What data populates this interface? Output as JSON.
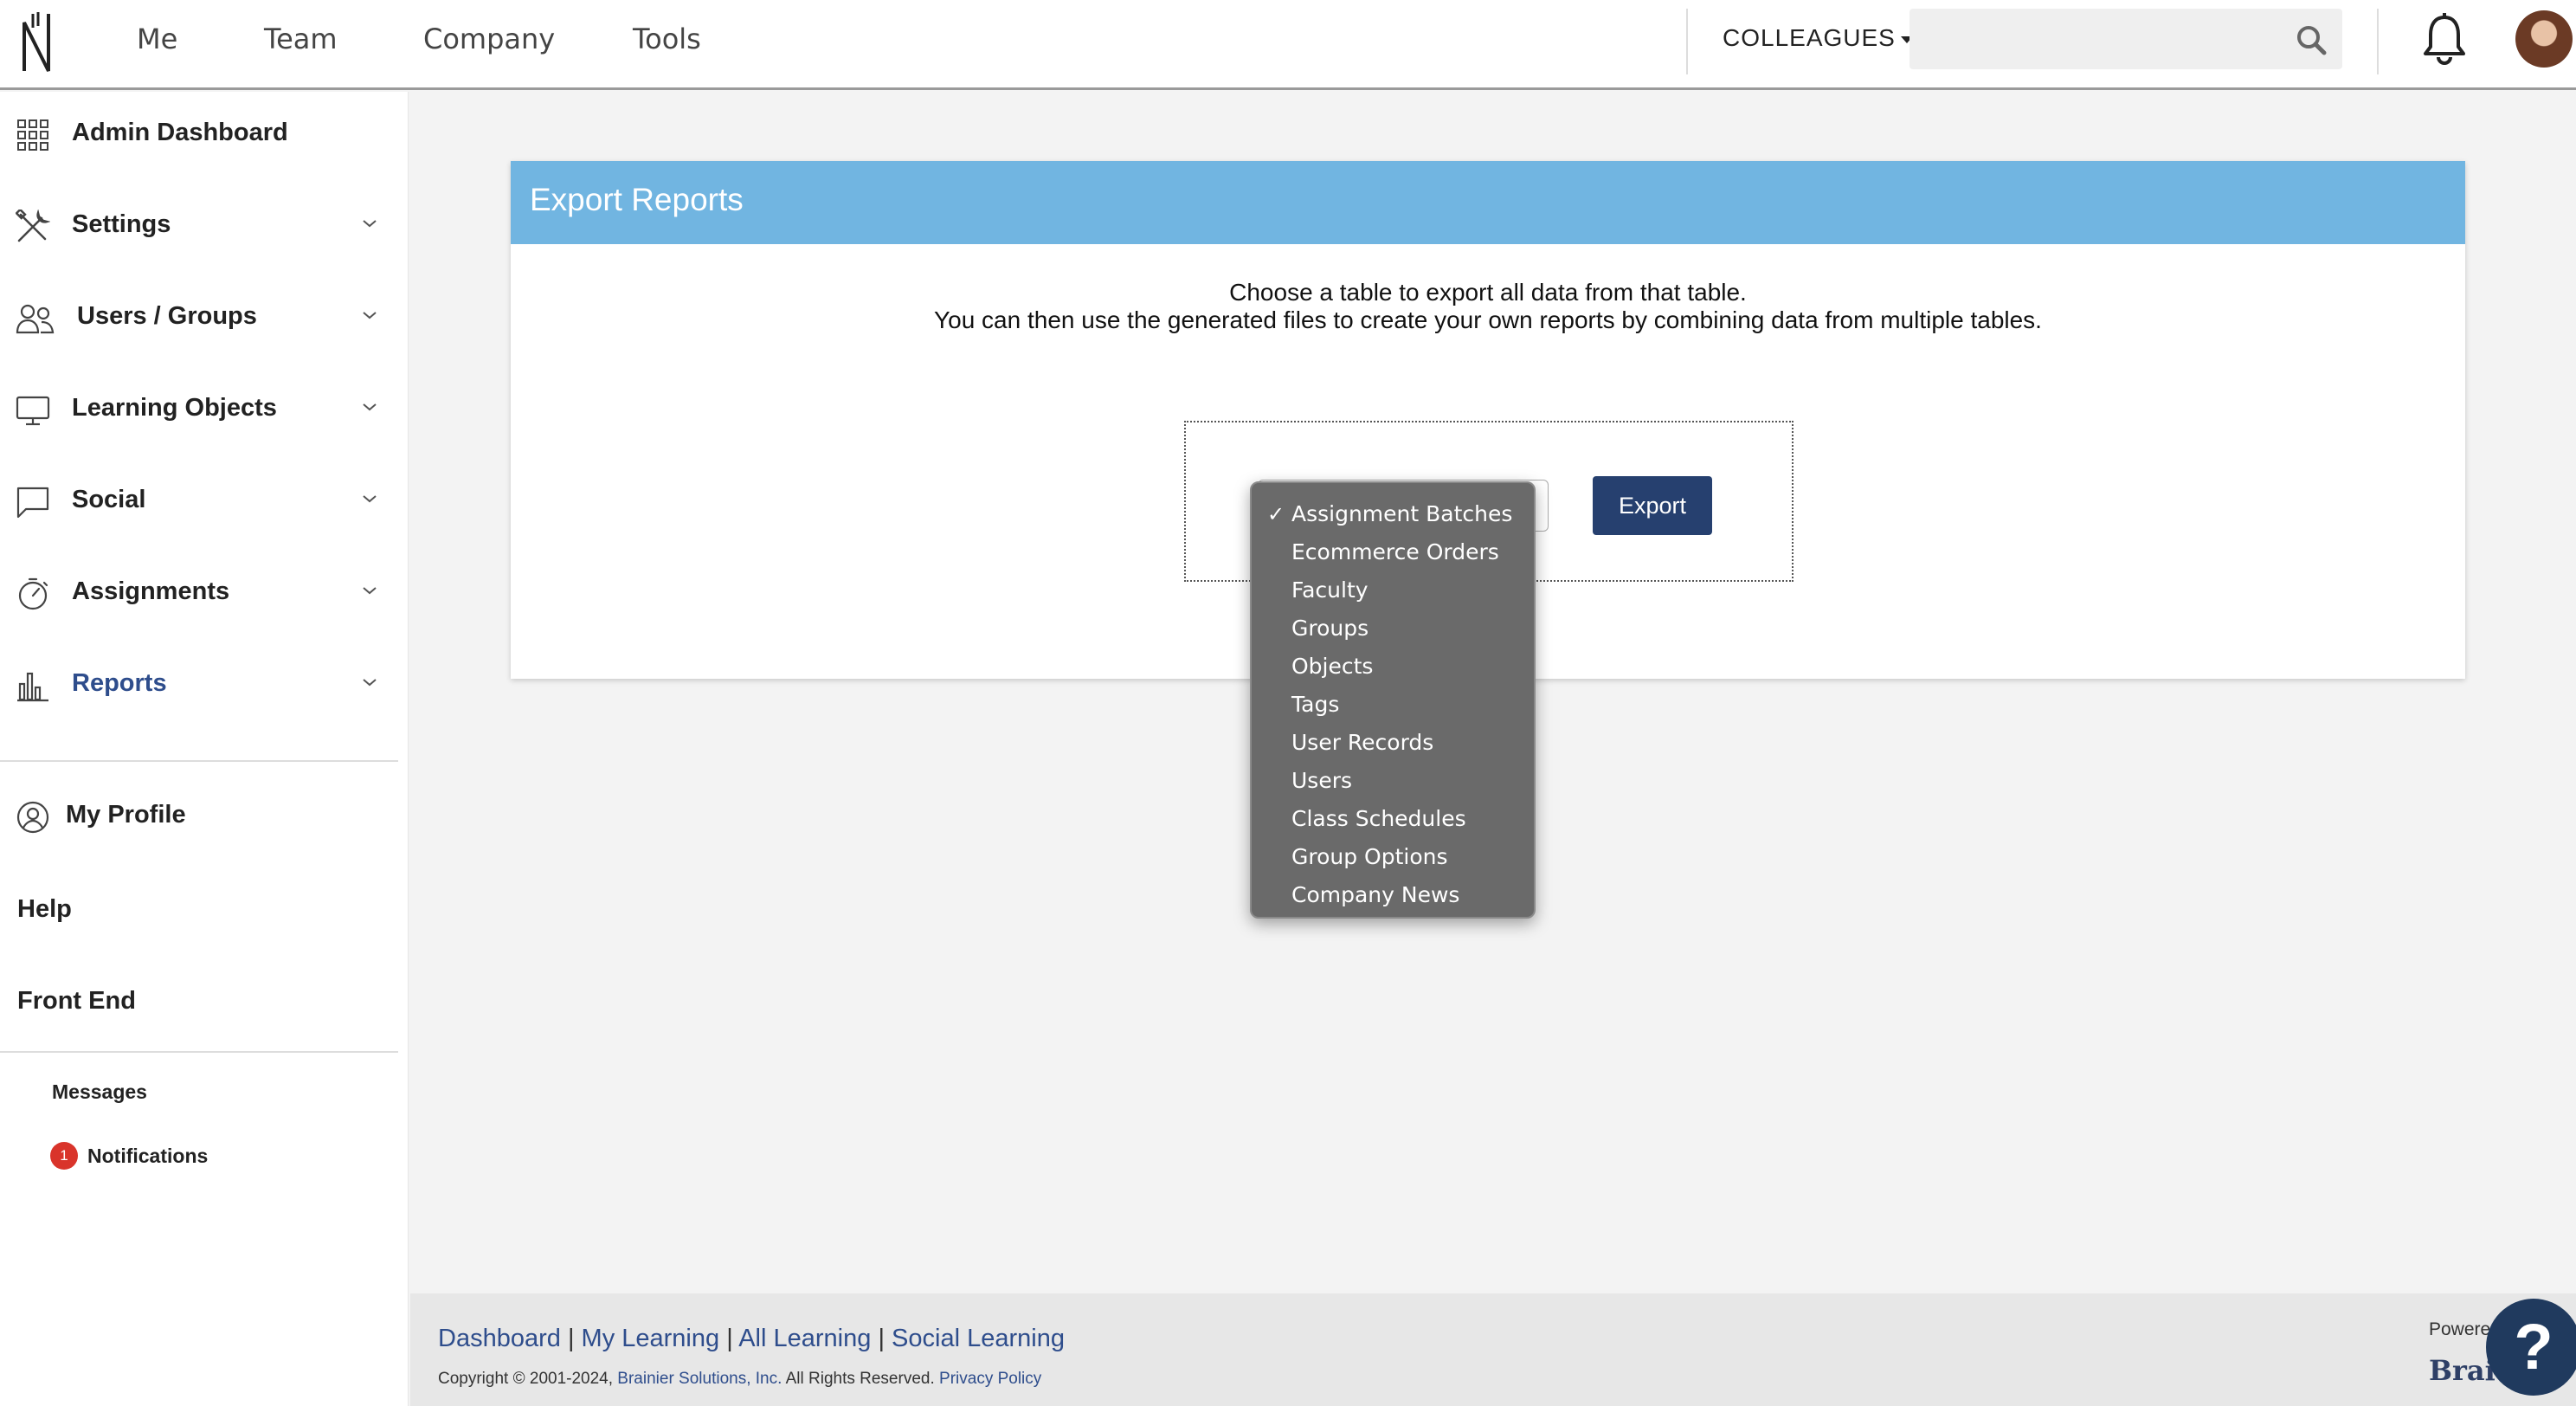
{
  "topnav": {
    "items": [
      "Me",
      "Team",
      "Company",
      "Tools"
    ],
    "colleagues_label": "COLLEAGUES",
    "search_placeholder": ""
  },
  "sidebar": {
    "items": [
      {
        "label": "Admin Dashboard",
        "icon": "grid-icon",
        "expandable": false
      },
      {
        "label": "Settings",
        "icon": "tools-icon",
        "expandable": true
      },
      {
        "label": "Users / Groups",
        "icon": "users-icon",
        "expandable": true
      },
      {
        "label": "Learning Objects",
        "icon": "monitor-icon",
        "expandable": true
      },
      {
        "label": "Social",
        "icon": "chat-icon",
        "expandable": true
      },
      {
        "label": "Assignments",
        "icon": "stopwatch-icon",
        "expandable": true
      },
      {
        "label": "Reports",
        "icon": "bar-chart-icon",
        "expandable": true,
        "active": true
      }
    ],
    "my_profile": "My Profile",
    "help": "Help",
    "front_end": "Front End",
    "messages": "Messages",
    "notifications": "Notifications",
    "notifications_count": "1"
  },
  "panel": {
    "title": "Export Reports",
    "instruction_1": "Choose a table to export all data from that table.",
    "instruction_2": "You can then use the generated files to create your own reports by combining data from multiple tables.",
    "export_button": "Export"
  },
  "dropdown": {
    "selected": "Assignment Batches",
    "options": [
      "Assignment Batches",
      "Ecommerce Orders",
      "Faculty",
      "Groups",
      "Objects",
      "Tags",
      "User Records",
      "Users",
      "Class Schedules",
      "Group Options",
      "Company News"
    ]
  },
  "footer": {
    "links": [
      "Dashboard",
      "My Learning",
      "All Learning",
      "Social Learning"
    ],
    "separator": "|",
    "copyright_prefix": "Copyright © 2001-2024, ",
    "company_link": "Brainier Solutions, Inc.",
    "copyright_suffix": " All Rights Reserved. ",
    "privacy_link": "Privacy Policy",
    "powered_by": "Powere",
    "brand": "Brai"
  },
  "help_button": "?",
  "colors": {
    "panel_header": "#71b5e1",
    "export_button": "#26406f",
    "reports_active": "#2e4d8c",
    "badge": "#d9342b"
  }
}
